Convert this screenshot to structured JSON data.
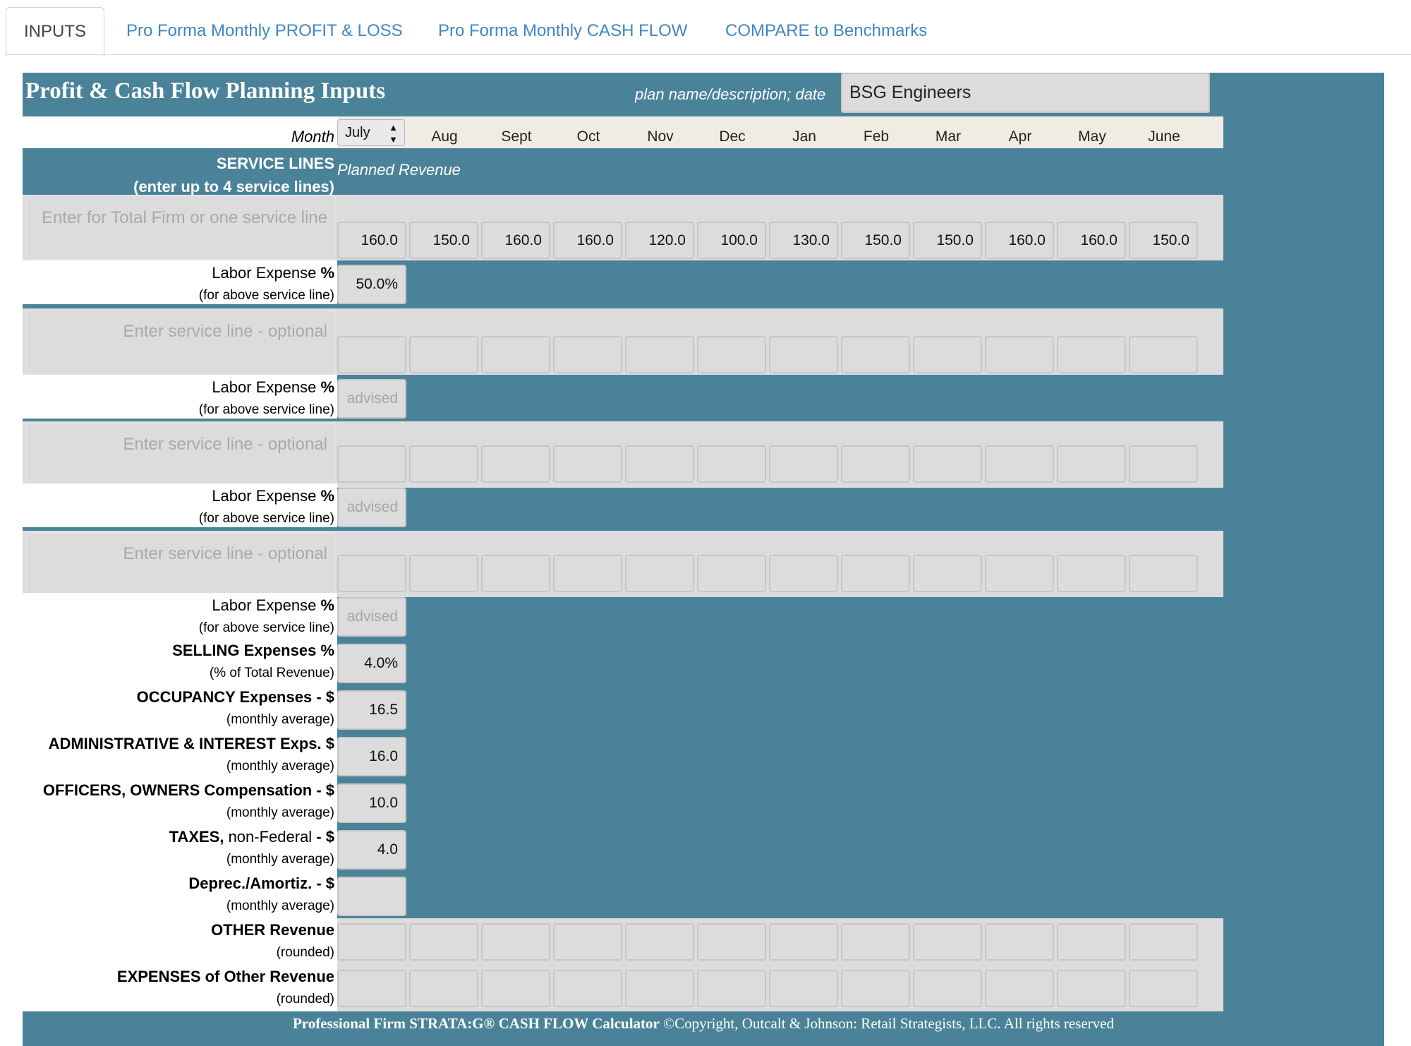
{
  "tabs": [
    {
      "label": "INPUTS",
      "active": true
    },
    {
      "label": "Pro Forma Monthly PROFIT & LOSS",
      "active": false
    },
    {
      "label": "Pro Forma Monthly CASH FLOW",
      "active": false
    },
    {
      "label": "COMPARE to Benchmarks",
      "active": false
    }
  ],
  "header": {
    "title": "Profit & Cash Flow Planning Inputs",
    "plan_label": "plan name/description; date",
    "plan_value": "BSG Engineers"
  },
  "months": {
    "label": "Month",
    "selected": "July",
    "list": [
      "Aug",
      "Sept",
      "Oct",
      "Nov",
      "Dec",
      "Jan",
      "Feb",
      "Mar",
      "Apr",
      "May",
      "June"
    ]
  },
  "service_lines": {
    "heading1": "SERVICE LINES",
    "heading2": "(enter up to 4 service lines)",
    "planned": "Planned Revenue",
    "lines": [
      {
        "placeholder": "Enter for Total Firm or one service line",
        "revenue": [
          "160.0",
          "150.0",
          "160.0",
          "160.0",
          "120.0",
          "100.0",
          "130.0",
          "150.0",
          "150.0",
          "160.0",
          "160.0",
          "150.0"
        ],
        "labor_value": "50.0%",
        "labor_placeholder": ""
      },
      {
        "placeholder": "Enter service line - optional",
        "revenue": [
          "",
          "",
          "",
          "",
          "",
          "",
          "",
          "",
          "",
          "",
          "",
          ""
        ],
        "labor_value": "",
        "labor_placeholder": "advised"
      },
      {
        "placeholder": "Enter service line - optional",
        "revenue": [
          "",
          "",
          "",
          "",
          "",
          "",
          "",
          "",
          "",
          "",
          "",
          ""
        ],
        "labor_value": "",
        "labor_placeholder": "advised"
      },
      {
        "placeholder": "Enter service line - optional",
        "revenue": [
          "",
          "",
          "",
          "",
          "",
          "",
          "",
          "",
          "",
          "",
          "",
          ""
        ],
        "labor_value": "",
        "labor_placeholder": "advised"
      }
    ],
    "labor_label": "Labor Expense",
    "labor_suffix": "%",
    "labor_sub": "(for above service line)"
  },
  "expenses": [
    {
      "bold": "SELLING Expenses %",
      "normal": "",
      "sub": "(% of Total Revenue)",
      "value": "4.0%"
    },
    {
      "bold": "OCCUPANCY Expenses - $",
      "normal": "",
      "sub": "(monthly average)",
      "value": "16.5"
    },
    {
      "bold": "ADMINISTRATIVE & INTEREST Exps. $",
      "normal": "",
      "sub": "(monthly average)",
      "value": "16.0"
    },
    {
      "bold": "OFFICERS, OWNERS Compensation - $",
      "normal": "",
      "sub": "(monthly average)",
      "value": "10.0"
    },
    {
      "bold": "TAXES,",
      "normal": " non-Federal ",
      "bold2": "- $",
      "sub": "(monthly average)",
      "value": "4.0"
    },
    {
      "bold": "Deprec./Amortiz. - $",
      "normal": "",
      "sub": "(monthly average)",
      "value": ""
    }
  ],
  "other": [
    {
      "label": "OTHER Revenue",
      "sub": "(rounded)"
    },
    {
      "label": "EXPENSES of Other Revenue",
      "sub": "(rounded)"
    }
  ],
  "footer": {
    "bold": "Professional  Firm  STRATA:G® CASH FLOW Calculator",
    "normal": "  ©Copyright, Outcalt & Johnson: Retail Strategists, LLC.  All rights reserved"
  },
  "colors": {
    "panel": "#4a8399",
    "tab_link": "#3f87c2",
    "input_bg": "#dcdcdc"
  }
}
